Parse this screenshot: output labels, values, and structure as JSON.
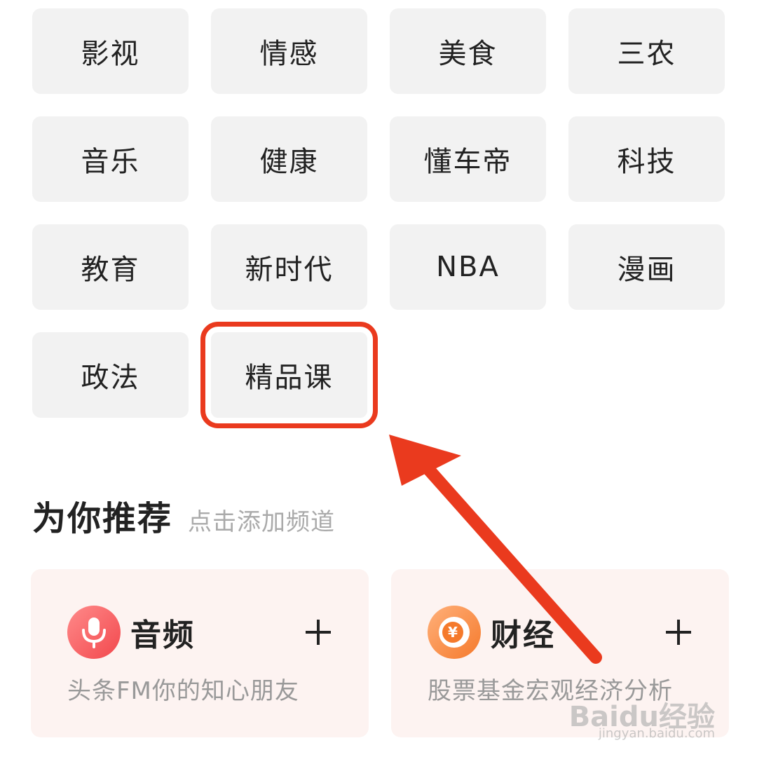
{
  "channels": [
    {
      "label": "影视"
    },
    {
      "label": "情感"
    },
    {
      "label": "美食"
    },
    {
      "label": "三农"
    },
    {
      "label": "音乐"
    },
    {
      "label": "健康"
    },
    {
      "label": "懂车帝"
    },
    {
      "label": "科技"
    },
    {
      "label": "教育"
    },
    {
      "label": "新时代"
    },
    {
      "label": "NBA"
    },
    {
      "label": "漫画"
    },
    {
      "label": "政法"
    },
    {
      "label": "精品课"
    }
  ],
  "recommend": {
    "title": "为你推荐",
    "subtitle": "点击添加频道",
    "cards": [
      {
        "name": "音频",
        "desc": "头条FM你的知心朋友",
        "icon": "microphone-icon",
        "color": "#f2484d"
      },
      {
        "name": "财经",
        "desc": "股票基金宏观经济分析",
        "icon": "yen-coin-icon",
        "color": "#f57a2c"
      }
    ]
  },
  "annotation": {
    "color": "#ea3a1e"
  },
  "watermark": {
    "brand": "Baidu经验",
    "url": "jingyan.baidu.com"
  }
}
